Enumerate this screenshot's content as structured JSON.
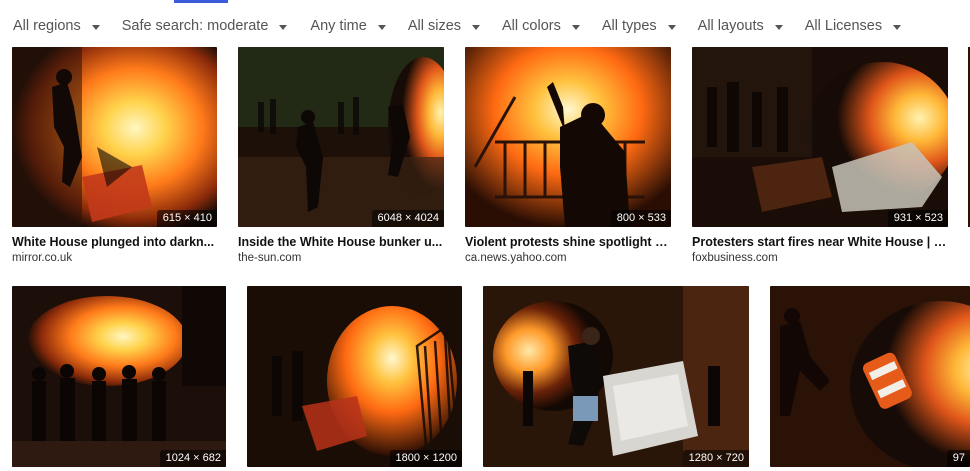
{
  "filters": [
    {
      "label": "All regions"
    },
    {
      "label": "Safe search: moderate"
    },
    {
      "label": "Any time"
    },
    {
      "label": "All sizes"
    },
    {
      "label": "All colors"
    },
    {
      "label": "All types"
    },
    {
      "label": "All layouts"
    },
    {
      "label": "All Licenses"
    }
  ],
  "row1": [
    {
      "dims": "615 × 410",
      "title": "White House plunged into darkn...",
      "source": "mirror.co.uk"
    },
    {
      "dims": "6048 × 4024",
      "title": "Inside the White House bunker u...",
      "source": "the-sun.com"
    },
    {
      "dims": "800 × 533",
      "title": "Violent protests shine spotlight o...",
      "source": "ca.news.yahoo.com"
    },
    {
      "dims": "931 × 523",
      "title": "Protesters start fires near White House | F...",
      "source": "foxbusiness.com"
    }
  ],
  "row2": [
    {
      "dims": "1024 × 682"
    },
    {
      "dims": "1800 × 1200"
    },
    {
      "dims": "1280 × 720"
    },
    {
      "dims": "97"
    }
  ],
  "colors": {
    "tab_underline": "#3b5bdb",
    "fire_bright": "#ffd24a",
    "fire_orange": "#ff7a1a",
    "night_dark": "#1a0d07"
  }
}
